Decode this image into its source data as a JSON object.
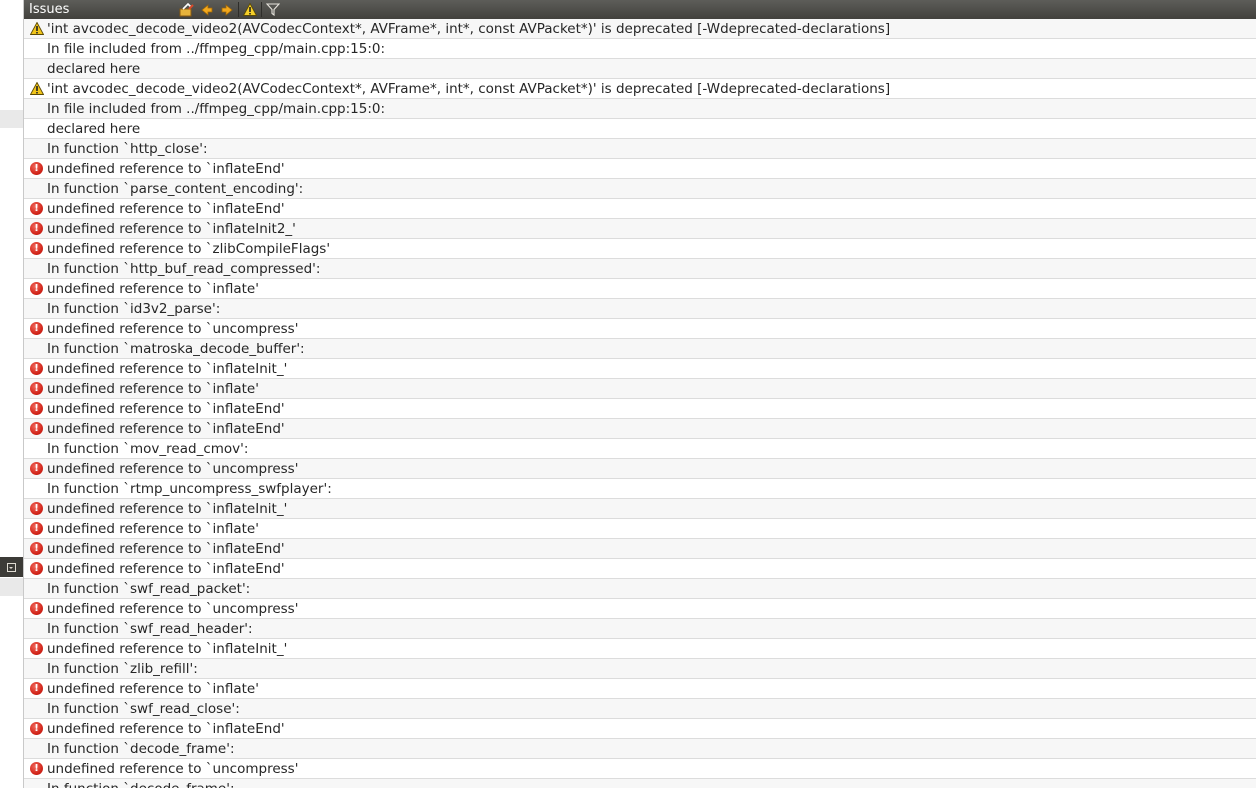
{
  "panel": {
    "title": "Issues",
    "toolbar": [
      {
        "name": "clear-icon",
        "label": ""
      },
      {
        "name": "prev-arrow-icon",
        "label": ""
      },
      {
        "name": "next-arrow-icon",
        "label": ""
      },
      {
        "name": "warning-filter-icon",
        "label": ""
      },
      {
        "name": "filter-icon",
        "label": ""
      }
    ]
  },
  "colors": {
    "error": "#d3271c",
    "warning": "#f0c419",
    "toolbar": "#4a4945"
  },
  "issues": [
    {
      "type": "warning",
      "text": "'int avcodec_decode_video2(AVCodecContext*, AVFrame*, int*, const AVPacket*)' is deprecated [-Wdeprecated-declarations]"
    },
    {
      "type": "info",
      "text": "In file included from ../ffmpeg_cpp/main.cpp:15:0:"
    },
    {
      "type": "info",
      "text": "declared here"
    },
    {
      "type": "warning",
      "text": "'int avcodec_decode_video2(AVCodecContext*, AVFrame*, int*, const AVPacket*)' is deprecated [-Wdeprecated-declarations]"
    },
    {
      "type": "info",
      "text": "In file included from ../ffmpeg_cpp/main.cpp:15:0:"
    },
    {
      "type": "info",
      "text": "declared here"
    },
    {
      "type": "info",
      "text": "In function `http_close':"
    },
    {
      "type": "error",
      "text": "undefined reference to `inflateEnd'"
    },
    {
      "type": "info",
      "text": "In function `parse_content_encoding':"
    },
    {
      "type": "error",
      "text": "undefined reference to `inflateEnd'"
    },
    {
      "type": "error",
      "text": "undefined reference to `inflateInit2_'"
    },
    {
      "type": "error",
      "text": "undefined reference to `zlibCompileFlags'"
    },
    {
      "type": "info",
      "text": "In function `http_buf_read_compressed':"
    },
    {
      "type": "error",
      "text": "undefined reference to `inflate'"
    },
    {
      "type": "info",
      "text": "In function `id3v2_parse':"
    },
    {
      "type": "error",
      "text": "undefined reference to `uncompress'"
    },
    {
      "type": "info",
      "text": "In function `matroska_decode_buffer':"
    },
    {
      "type": "error",
      "text": "undefined reference to `inflateInit_'"
    },
    {
      "type": "error",
      "text": "undefined reference to `inflate'"
    },
    {
      "type": "error",
      "text": "undefined reference to `inflateEnd'"
    },
    {
      "type": "error",
      "text": "undefined reference to `inflateEnd'"
    },
    {
      "type": "info",
      "text": "In function `mov_read_cmov':"
    },
    {
      "type": "error",
      "text": "undefined reference to `uncompress'"
    },
    {
      "type": "info",
      "text": "In function `rtmp_uncompress_swfplayer':"
    },
    {
      "type": "error",
      "text": "undefined reference to `inflateInit_'"
    },
    {
      "type": "error",
      "text": "undefined reference to `inflate'"
    },
    {
      "type": "error",
      "text": "undefined reference to `inflateEnd'"
    },
    {
      "type": "error",
      "text": "undefined reference to `inflateEnd'"
    },
    {
      "type": "info",
      "text": "In function `swf_read_packet':"
    },
    {
      "type": "error",
      "text": "undefined reference to `uncompress'"
    },
    {
      "type": "info",
      "text": "In function `swf_read_header':"
    },
    {
      "type": "error",
      "text": "undefined reference to `inflateInit_'"
    },
    {
      "type": "info",
      "text": "In function `zlib_refill':"
    },
    {
      "type": "error",
      "text": "undefined reference to `inflate'"
    },
    {
      "type": "info",
      "text": "In function `swf_read_close':"
    },
    {
      "type": "error",
      "text": "undefined reference to `inflateEnd'"
    },
    {
      "type": "info",
      "text": "In function `decode_frame':"
    },
    {
      "type": "error",
      "text": "undefined reference to `uncompress'"
    },
    {
      "type": "info",
      "text": "In function `decode_frame':"
    }
  ]
}
